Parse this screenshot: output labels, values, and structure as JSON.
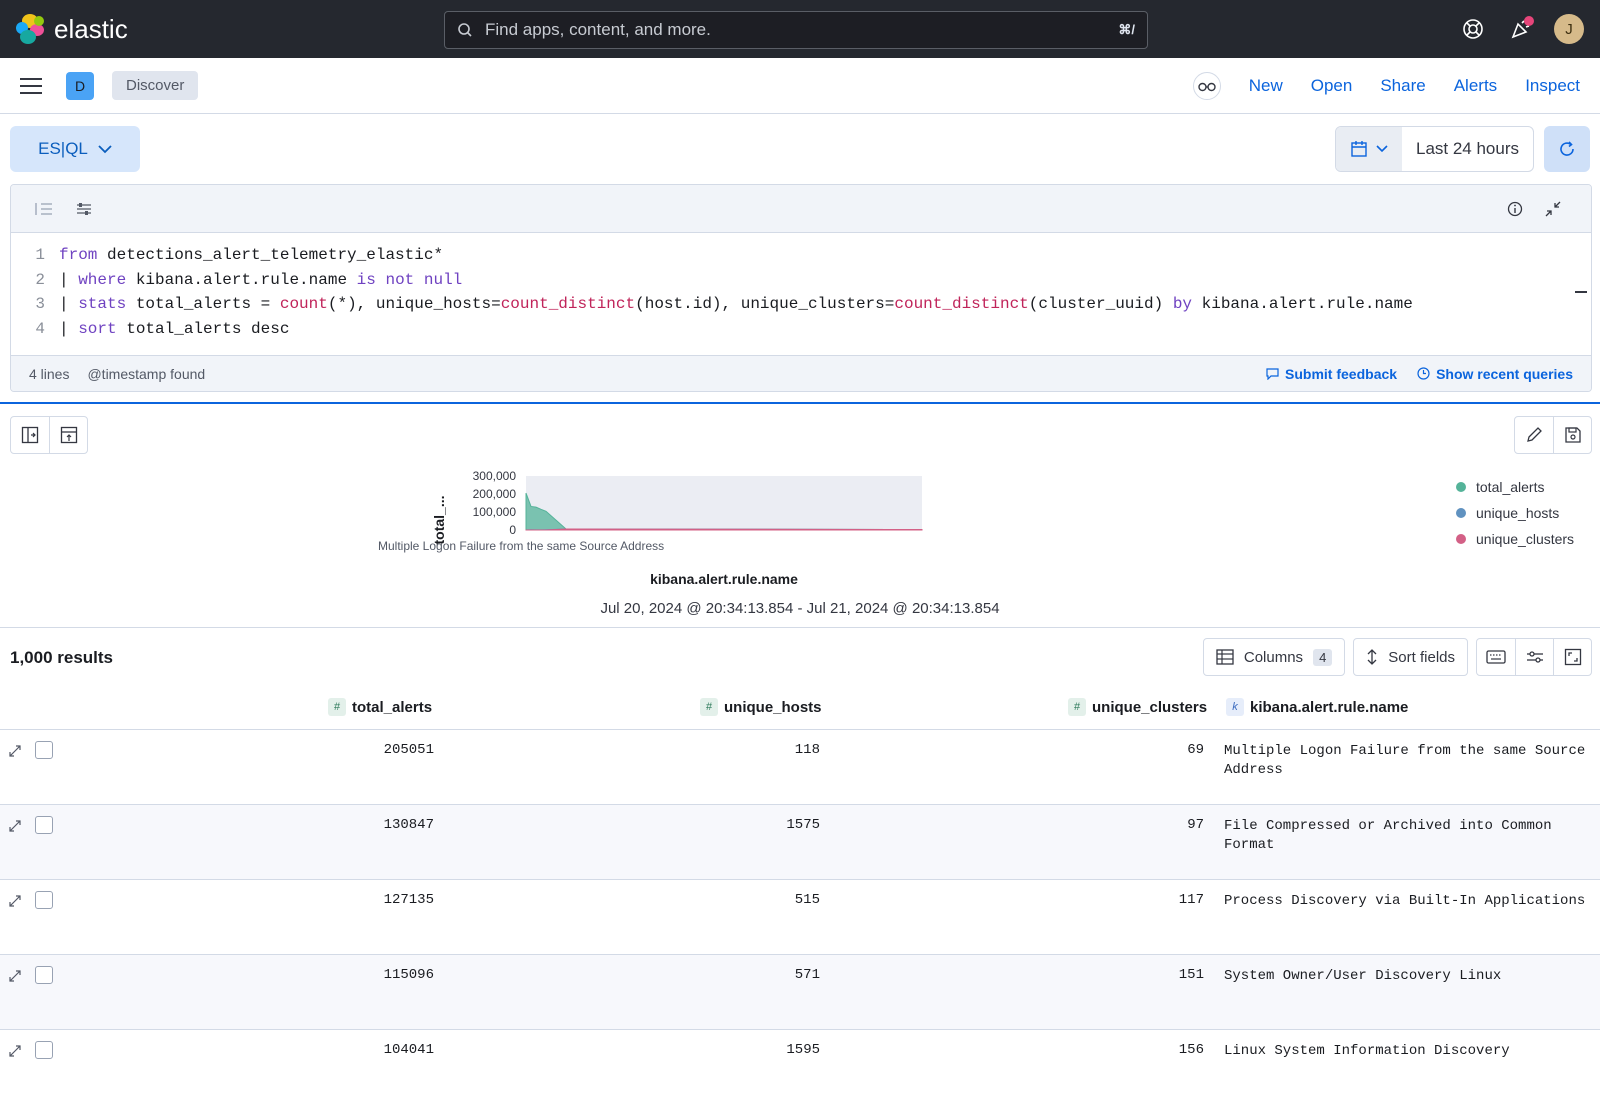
{
  "topbar": {
    "brand": "elastic",
    "search_placeholder": "Find apps, content, and more.",
    "search_shortcut": "⌘/",
    "avatar_initial": "J"
  },
  "nav": {
    "space_initial": "D",
    "breadcrumb": "Discover",
    "links": [
      "New",
      "Open",
      "Share",
      "Alerts",
      "Inspect"
    ]
  },
  "query": {
    "mode_label": "ES|QL",
    "time_range": "Last 24 hours"
  },
  "editor": {
    "line_numbers": [
      "1",
      "2",
      "3",
      "4"
    ],
    "status_lines": "4 lines",
    "status_timestamp": "@timestamp found",
    "submit_feedback": "Submit feedback",
    "show_recent": "Show recent queries"
  },
  "chart": {
    "legend": [
      "total_alerts",
      "unique_hosts",
      "unique_clusters"
    ],
    "legend_colors": [
      "#54b399",
      "#6092c0",
      "#d36086"
    ],
    "timespan": "Jul 20, 2024 @ 20:34:13.854 - Jul 21, 2024 @ 20:34:13.854"
  },
  "chart_data": {
    "type": "area",
    "ylabel": "total_...",
    "xlabel": "kibana.alert.rule.name",
    "x_tick_labels": [
      "Multiple Logon Failure from the same Source Address"
    ],
    "y_ticks": [
      "300,000",
      "200,000",
      "100,000",
      "0"
    ],
    "ylim": [
      0,
      300000
    ],
    "series": [
      {
        "name": "total_alerts",
        "values": [
          205051,
          130847,
          127135,
          115096,
          104041
        ]
      },
      {
        "name": "unique_hosts",
        "values": [
          118,
          1575,
          515,
          571,
          1595
        ]
      },
      {
        "name": "unique_clusters",
        "values": [
          69,
          97,
          117,
          151,
          156
        ]
      }
    ]
  },
  "results": {
    "count": "1,000 results",
    "columns_label": "Columns",
    "columns_count": "4",
    "sort_label": "Sort fields",
    "headers": [
      "total_alerts",
      "unique_hosts",
      "unique_clusters",
      "kibana.alert.rule.name"
    ],
    "rows": [
      {
        "total_alerts": "205051",
        "unique_hosts": "118",
        "unique_clusters": "69",
        "rule": "Multiple Logon Failure from the same Source Address"
      },
      {
        "total_alerts": "130847",
        "unique_hosts": "1575",
        "unique_clusters": "97",
        "rule": "File Compressed or Archived into Common Format"
      },
      {
        "total_alerts": "127135",
        "unique_hosts": "515",
        "unique_clusters": "117",
        "rule": "Process Discovery via Built-In Applications"
      },
      {
        "total_alerts": "115096",
        "unique_hosts": "571",
        "unique_clusters": "151",
        "rule": "System Owner/User Discovery Linux"
      },
      {
        "total_alerts": "104041",
        "unique_hosts": "1595",
        "unique_clusters": "156",
        "rule": "Linux System Information Discovery"
      }
    ]
  }
}
